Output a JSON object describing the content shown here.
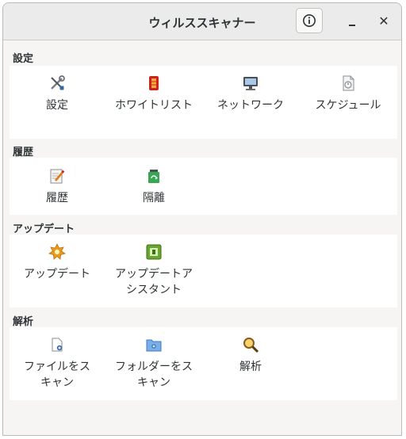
{
  "window": {
    "title": "ウィルススキャナー",
    "info_icon": "info-icon",
    "minimize_icon": "minimize-icon",
    "close_glyph": "✕"
  },
  "sections": {
    "settings": {
      "label": "設定",
      "items": [
        {
          "label": "設定",
          "icon": "tools-icon"
        },
        {
          "label": "ホワイトリスト",
          "icon": "whitelist-icon"
        },
        {
          "label": "ネットワーク",
          "icon": "network-icon"
        },
        {
          "label": "スケジュール",
          "icon": "schedule-icon"
        }
      ]
    },
    "history": {
      "label": "履歴",
      "items": [
        {
          "label": "履歴",
          "icon": "history-icon"
        },
        {
          "label": "隔離",
          "icon": "quarantine-icon"
        }
      ]
    },
    "update": {
      "label": "アップデート",
      "items": [
        {
          "label": "アップデート",
          "icon": "update-icon"
        },
        {
          "label": "アップデートア\nシスタント",
          "icon": "update-assistant-icon"
        }
      ]
    },
    "analysis": {
      "label": "解析",
      "items": [
        {
          "label": "ファイルをス\nキャン",
          "icon": "scan-file-icon"
        },
        {
          "label": "フォルダーをス\nキャン",
          "icon": "scan-folder-icon"
        },
        {
          "label": "解析",
          "icon": "magnifier-icon"
        }
      ]
    }
  },
  "colors": {
    "background": "#f6f5f4",
    "panel": "#ffffff",
    "text": "#2e3436"
  }
}
